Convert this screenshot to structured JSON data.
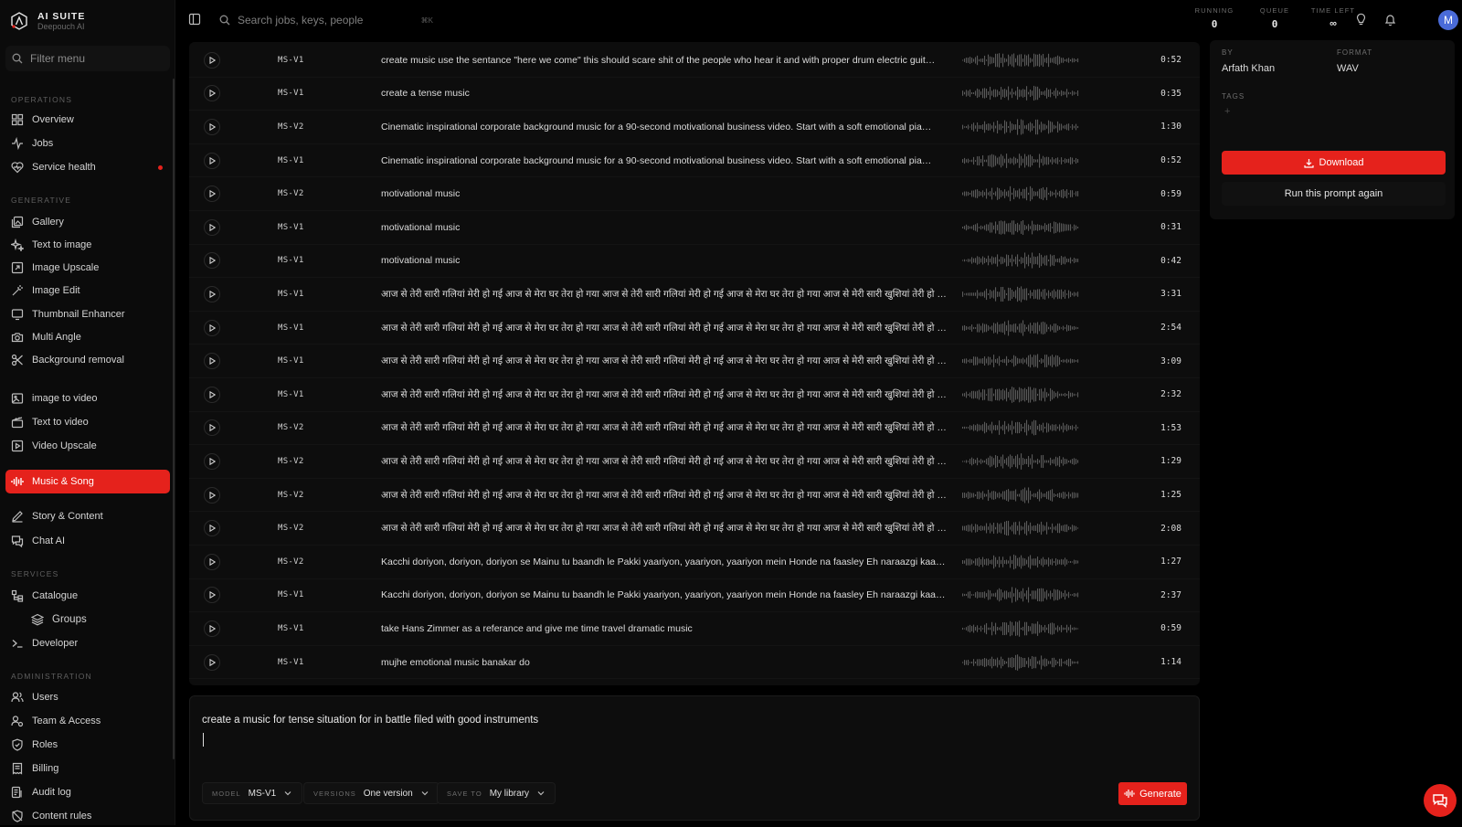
{
  "brand": {
    "name": "AI SUITE",
    "subtitle": "Deepouch AI"
  },
  "sidebar": {
    "filter_placeholder": "Filter menu",
    "sections": {
      "operations": "OPERATIONS",
      "generative": "GENERATIVE",
      "services": "SERVICES",
      "administration": "ADMINISTRATION"
    },
    "items": {
      "overview": "Overview",
      "jobs": "Jobs",
      "service_health": "Service health",
      "gallery": "Gallery",
      "text_to_image": "Text to image",
      "image_upscale": "Image Upscale",
      "image_edit": "Image Edit",
      "thumbnail_enhancer": "Thumbnail Enhancer",
      "multi_angle": "Multi Angle",
      "background_removal": "Background removal",
      "image_to_video": "image to video",
      "text_to_video": "Text to video",
      "video_upscale": "Video Upscale",
      "music_song": "Music & Song",
      "story_content": "Story & Content",
      "chat_ai": "Chat AI",
      "catalogue": "Catalogue",
      "groups": "Groups",
      "developer": "Developer",
      "users": "Users",
      "team_access": "Team & Access",
      "roles": "Roles",
      "billing": "Billing",
      "audit_log": "Audit log",
      "content_rules": "Content rules"
    }
  },
  "topbar": {
    "search_placeholder": "Search jobs, keys, people",
    "search_shortcut": "⌘K",
    "stats": {
      "running_label": "RUNNING",
      "running_value": "0",
      "queue_label": "QUEUE",
      "queue_value": "0",
      "time_left_label": "TIME LEFT",
      "time_left_value": "∞"
    },
    "avatar_initial": "M"
  },
  "tracks": [
    {
      "model": "MS-V1",
      "prompt": "create music use the sentance \"here we come\" this should scare shit of the people who hear it and with proper drum electric guit…",
      "duration": "0:52"
    },
    {
      "model": "MS-V1",
      "prompt": "create a tense music",
      "duration": "0:35"
    },
    {
      "model": "MS-V2",
      "prompt": "Cinematic inspirational corporate background music for a 90-second motivational business video. Start with a soft emotional pia…",
      "duration": "1:30"
    },
    {
      "model": "MS-V1",
      "prompt": "Cinematic inspirational corporate background music for a 90-second motivational business video. Start with a soft emotional pia…",
      "duration": "0:52"
    },
    {
      "model": "MS-V2",
      "prompt": "motivational music",
      "duration": "0:59"
    },
    {
      "model": "MS-V1",
      "prompt": "motivational music",
      "duration": "0:31"
    },
    {
      "model": "MS-V1",
      "prompt": "motivational music",
      "duration": "0:42"
    },
    {
      "model": "MS-V1",
      "prompt": "आज से तेरी सारी गलियां मेरी हो गई आज से मेरा घर तेरा हो गया आज से तेरी सारी गलियां मेरी हो गई आज से मेरा घर तेरा हो गया आज से मेरी सारी खुशियां तेरी हो गई …",
      "duration": "3:31"
    },
    {
      "model": "MS-V1",
      "prompt": "आज से तेरी सारी गलियां मेरी हो गई आज से मेरा घर तेरा हो गया आज से तेरी सारी गलियां मेरी हो गई आज से मेरा घर तेरा हो गया आज से मेरी सारी खुशियां तेरी हो गई …",
      "duration": "2:54"
    },
    {
      "model": "MS-V1",
      "prompt": "आज से तेरी सारी गलियां मेरी हो गई आज से मेरा घर तेरा हो गया आज से तेरी सारी गलियां मेरी हो गई आज से मेरा घर तेरा हो गया आज से मेरी सारी खुशियां तेरी हो गई …",
      "duration": "3:09"
    },
    {
      "model": "MS-V1",
      "prompt": "आज से तेरी सारी गलियां मेरी हो गई आज से मेरा घर तेरा हो गया आज से तेरी सारी गलियां मेरी हो गई आज से मेरा घर तेरा हो गया आज से मेरी सारी खुशियां तेरी हो गई …",
      "duration": "2:32"
    },
    {
      "model": "MS-V2",
      "prompt": "आज से तेरी सारी गलियां मेरी हो गई आज से मेरा घर तेरा हो गया आज से तेरी सारी गलियां मेरी हो गई आज से मेरा घर तेरा हो गया आज से मेरी सारी खुशियां तेरी हो गई …",
      "duration": "1:53"
    },
    {
      "model": "MS-V2",
      "prompt": "आज से तेरी सारी गलियां मेरी हो गई आज से मेरा घर तेरा हो गया आज से तेरी सारी गलियां मेरी हो गई आज से मेरा घर तेरा हो गया आज से मेरी सारी खुशियां तेरी हो गई …",
      "duration": "1:29"
    },
    {
      "model": "MS-V2",
      "prompt": "आज से तेरी सारी गलियां मेरी हो गई आज से मेरा घर तेरा हो गया आज से तेरी सारी गलियां मेरी हो गई आज से मेरा घर तेरा हो गया आज से मेरी सारी खुशियां तेरी हो गई …",
      "duration": "1:25"
    },
    {
      "model": "MS-V2",
      "prompt": "आज से तेरी सारी गलियां मेरी हो गई आज से मेरा घर तेरा हो गया आज से तेरी सारी गलियां मेरी हो गई आज से मेरा घर तेरा हो गया आज से मेरी सारी खुशियां तेरी हो गई …",
      "duration": "2:08"
    },
    {
      "model": "MS-V2",
      "prompt": "Kacchi doriyon, doriyon, doriyon se Mainu tu baandh le Pakki yaariyon, yaariyon, yaariyon mein Honde na faasley Eh naraazgi kaa…",
      "duration": "1:27"
    },
    {
      "model": "MS-V1",
      "prompt": "Kacchi doriyon, doriyon, doriyon se Mainu tu baandh le Pakki yaariyon, yaariyon, yaariyon mein Honde na faasley Eh naraazgi kaa…",
      "duration": "2:37"
    },
    {
      "model": "MS-V1",
      "prompt": "take Hans Zimmer as a referance and give me time travel dramatic music",
      "duration": "0:59"
    },
    {
      "model": "MS-V1",
      "prompt": "mujhe emotional music banakar do",
      "duration": "1:14"
    }
  ],
  "details": {
    "by_label": "BY",
    "by_value": "Arfath Khan",
    "format_label": "FORMAT",
    "format_value": "WAV",
    "tags_label": "TAGS",
    "add_tag": "+",
    "download_label": "Download",
    "run_again_label": "Run this prompt again"
  },
  "composer": {
    "prompt_text": "create a music for tense situation for in battle filed with good instruments",
    "model_label": "MODEL",
    "model_value": "MS-V1",
    "versions_label": "VERSIONS",
    "versions_value": "One version",
    "save_to_label": "SAVE TO",
    "save_to_value": "My library",
    "generate_label": "Generate"
  },
  "colors": {
    "accent": "#e5221c",
    "background": "#000000",
    "panel": "#0d0d0d"
  }
}
